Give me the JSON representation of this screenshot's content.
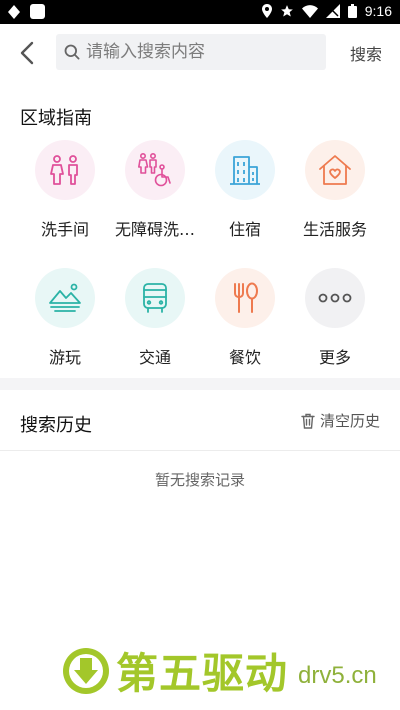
{
  "status_bar": {
    "time": "9:16"
  },
  "header": {
    "search_placeholder": "请输入搜索内容",
    "search_button": "搜索"
  },
  "guide": {
    "title": "区域指南",
    "items": [
      {
        "label": "洗手间",
        "icon": "restroom-icon",
        "bg": "#fbeef5"
      },
      {
        "label": "无障碍洗…",
        "icon": "accessible-restroom-icon",
        "bg": "#fbeef5"
      },
      {
        "label": "住宿",
        "icon": "building-icon",
        "bg": "#eaf6fb"
      },
      {
        "label": "生活服务",
        "icon": "home-heart-icon",
        "bg": "#fdf0ea"
      },
      {
        "label": "游玩",
        "icon": "scenery-icon",
        "bg": "#e8f7f6"
      },
      {
        "label": "交通",
        "icon": "bus-icon",
        "bg": "#e8f7f6"
      },
      {
        "label": "餐饮",
        "icon": "dining-icon",
        "bg": "#fdf0ea"
      },
      {
        "label": "更多",
        "icon": "more-icon",
        "bg": "#f1f1f3"
      }
    ]
  },
  "history": {
    "title": "搜索历史",
    "clear_label": "清空历史",
    "empty_text": "暂无搜索记录"
  },
  "watermark": {
    "text": "第五驱动",
    "domain": "drv5.cn"
  }
}
